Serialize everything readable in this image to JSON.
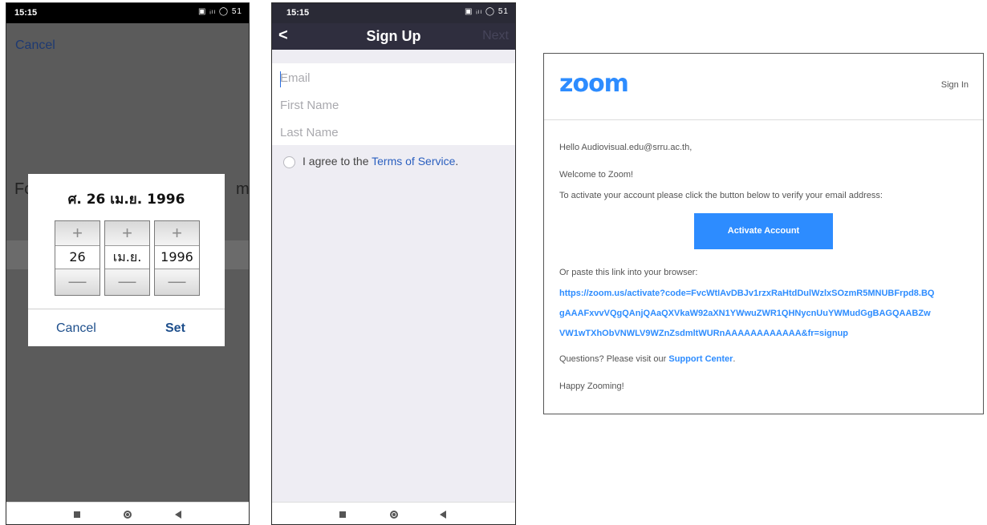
{
  "phone1": {
    "status": {
      "time": "15:15",
      "icons": "▣ ᵢₗₗ ◯ 51",
      "battery": "51"
    },
    "cancel_top": "Cancel",
    "bg_text_left": "Fo",
    "bg_text_right": "m",
    "dialog": {
      "title": "ศ. 26 เม.ย. 1996",
      "day": "26",
      "month": "เม.ย.",
      "year": "1996",
      "plus": "+",
      "minus": "—",
      "cancel": "Cancel",
      "set": "Set"
    }
  },
  "phone2": {
    "status": {
      "time": "15:15",
      "icons": "▣ ᵢₗₗ ◯ 51"
    },
    "header": {
      "back": "<",
      "title": "Sign Up",
      "next": "Next"
    },
    "fields": {
      "email_placeholder": "Email",
      "first_name_placeholder": "First Name",
      "last_name_placeholder": "Last Name"
    },
    "agree_prefix": "I agree to the ",
    "agree_link": "Terms of Service",
    "agree_suffix": "."
  },
  "email": {
    "logo": "zoom",
    "signin": "Sign In",
    "greeting": "Hello Audiovisual.edu@srru.ac.th,",
    "welcome": "Welcome to Zoom!",
    "instruction": "To activate your account please click the button below to verify your email address:",
    "button": "Activate Account",
    "paste_text": "Or paste this link into your browser:",
    "link_lines": [
      "https://zoom.us/activate?code=FvcWtIAvDBJv1rzxRaHtdDulWzlxSOzmR5MNUBFrpd8.BQ",
      "gAAAFxvvVQgQAnjQAaQXVkaW92aXN1YWwuZWR1QHNycnUuYWMudGgBAGQAABZw",
      "VW1wTXhObVNWLV9WZnZsdmltWURnAAAAAAAAAAAA&fr=signup"
    ],
    "questions_prefix": "Questions? Please visit our ",
    "support_link": "Support Center",
    "questions_suffix": ".",
    "closing": "Happy Zooming!"
  },
  "colors": {
    "zoom_blue": "#2d8cff",
    "signup_header": "#2f2e3e",
    "picker_overlay": "#5b5b5b"
  }
}
